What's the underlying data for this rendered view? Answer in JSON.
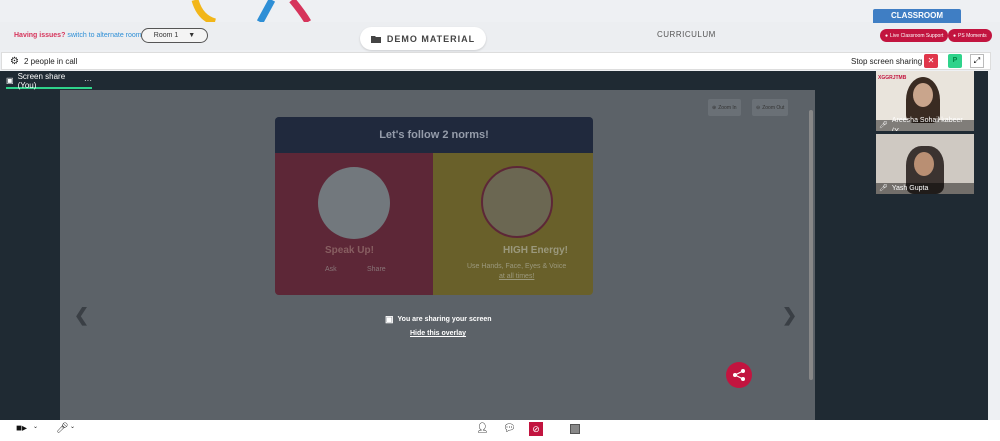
{
  "topbar": {
    "issues_question": "Having issues?",
    "issues_link": "switch to alternate room",
    "room_select": "Room 1",
    "demo_button": "DEMO MATERIAL",
    "curriculum": "CURRICULUM",
    "classroom_tab": "CLASSROOM",
    "live_support": "Live Classroom Support",
    "ps_moments": "PS Moments"
  },
  "callbar": {
    "people": "2 people in call",
    "stop_share": "Stop screen sharing",
    "close": "✕",
    "p_label": "P",
    "expand": "⤢"
  },
  "stage": {
    "share_tab": "Screen share (You)",
    "share_tab_menu": "···",
    "zoom_in": "Zoom In",
    "zoom_out": "Zoom Out",
    "slide": {
      "title": "Let's follow 2 norms!",
      "left_title": "Speak Up!",
      "left_ask": "Ask",
      "left_share": "Share",
      "right_title": "HIGH Energy!",
      "right_text": "Use Hands, Face, Eyes & Voice",
      "right_link": "at all times!"
    },
    "overlay_msg": "You are sharing your screen",
    "overlay_hide": "Hide this overlay",
    "prev": "❮",
    "next": "❯"
  },
  "participants": [
    {
      "name": "Areesha Sohail kabeer (Y...",
      "corner_text": "XGGRJTMB"
    },
    {
      "name": "Yash Gupta"
    }
  ],
  "colors": {
    "accent_red": "#c2143f",
    "accent_blue": "#3f7ec4",
    "accent_green": "#2fd38b"
  }
}
